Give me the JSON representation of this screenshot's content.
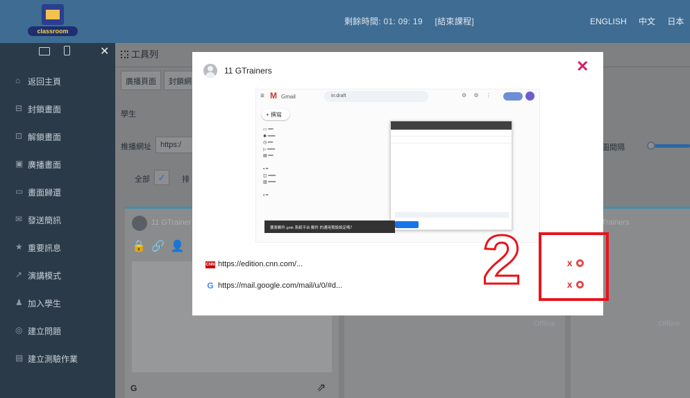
{
  "topbar": {
    "logo_text": "classroom",
    "remaining_time": "剩餘時間: 01: 09: 19",
    "end_class": "[結束課程]",
    "languages": [
      "ENGLISH",
      "中文",
      "日本"
    ]
  },
  "sidebar": {
    "items": [
      {
        "icon": "home-icon",
        "label": "返回主頁"
      },
      {
        "icon": "lock-icon",
        "label": "封鎖畫面"
      },
      {
        "icon": "unlock-icon",
        "label": "解鎖畫面"
      },
      {
        "icon": "broadcast-icon",
        "label": "廣播畫面"
      },
      {
        "icon": "monitor-icon",
        "label": "畫面歸還"
      },
      {
        "icon": "message-icon",
        "label": "發送簡訊"
      },
      {
        "icon": "star-icon",
        "label": "重要訊息"
      },
      {
        "icon": "presentation-icon",
        "label": "演講模式"
      },
      {
        "icon": "add-student-icon",
        "label": "加入學生"
      },
      {
        "icon": "poll-icon",
        "label": "建立問題"
      },
      {
        "icon": "quiz-icon",
        "label": "建立測驗作業"
      }
    ]
  },
  "main": {
    "toolbar_title": "工具列",
    "tabs": [
      "廣播頁面",
      "封鎖網"
    ],
    "student_label": "學生",
    "url_label": "推播網址",
    "url_value": "https:/",
    "all_label": "全部",
    "sort_label": "排",
    "interval_label": "截圖間隔",
    "cards": [
      {
        "name": "11 GTrainer"
      },
      {
        "name": "",
        "status": "Offline"
      },
      {
        "name": "GTrainers",
        "status": "Offline"
      }
    ]
  },
  "modal": {
    "student_name": "11 GTrainers",
    "close_symbol": "✕",
    "preview": {
      "app_name": "Gmail",
      "search_text": "in:draft",
      "compose_label": "撰寫",
      "toast_text": "要將郵件 gmk 系統平台 郵件 的通用預設設定嗎？"
    },
    "tabs": [
      {
        "favicon": "CNN",
        "url": "https://edition.cnn.com/..."
      },
      {
        "favicon": "G",
        "url": "https://mail.google.com/mail/u/0/#d..."
      }
    ],
    "close_tab_label": "X"
  },
  "annotation": {
    "number": "2"
  },
  "colors": {
    "topbar": "#3f6c93",
    "sidebar": "#2b3a48",
    "accent_pink": "#d31d6b",
    "annotation_red": "#e8131b"
  }
}
